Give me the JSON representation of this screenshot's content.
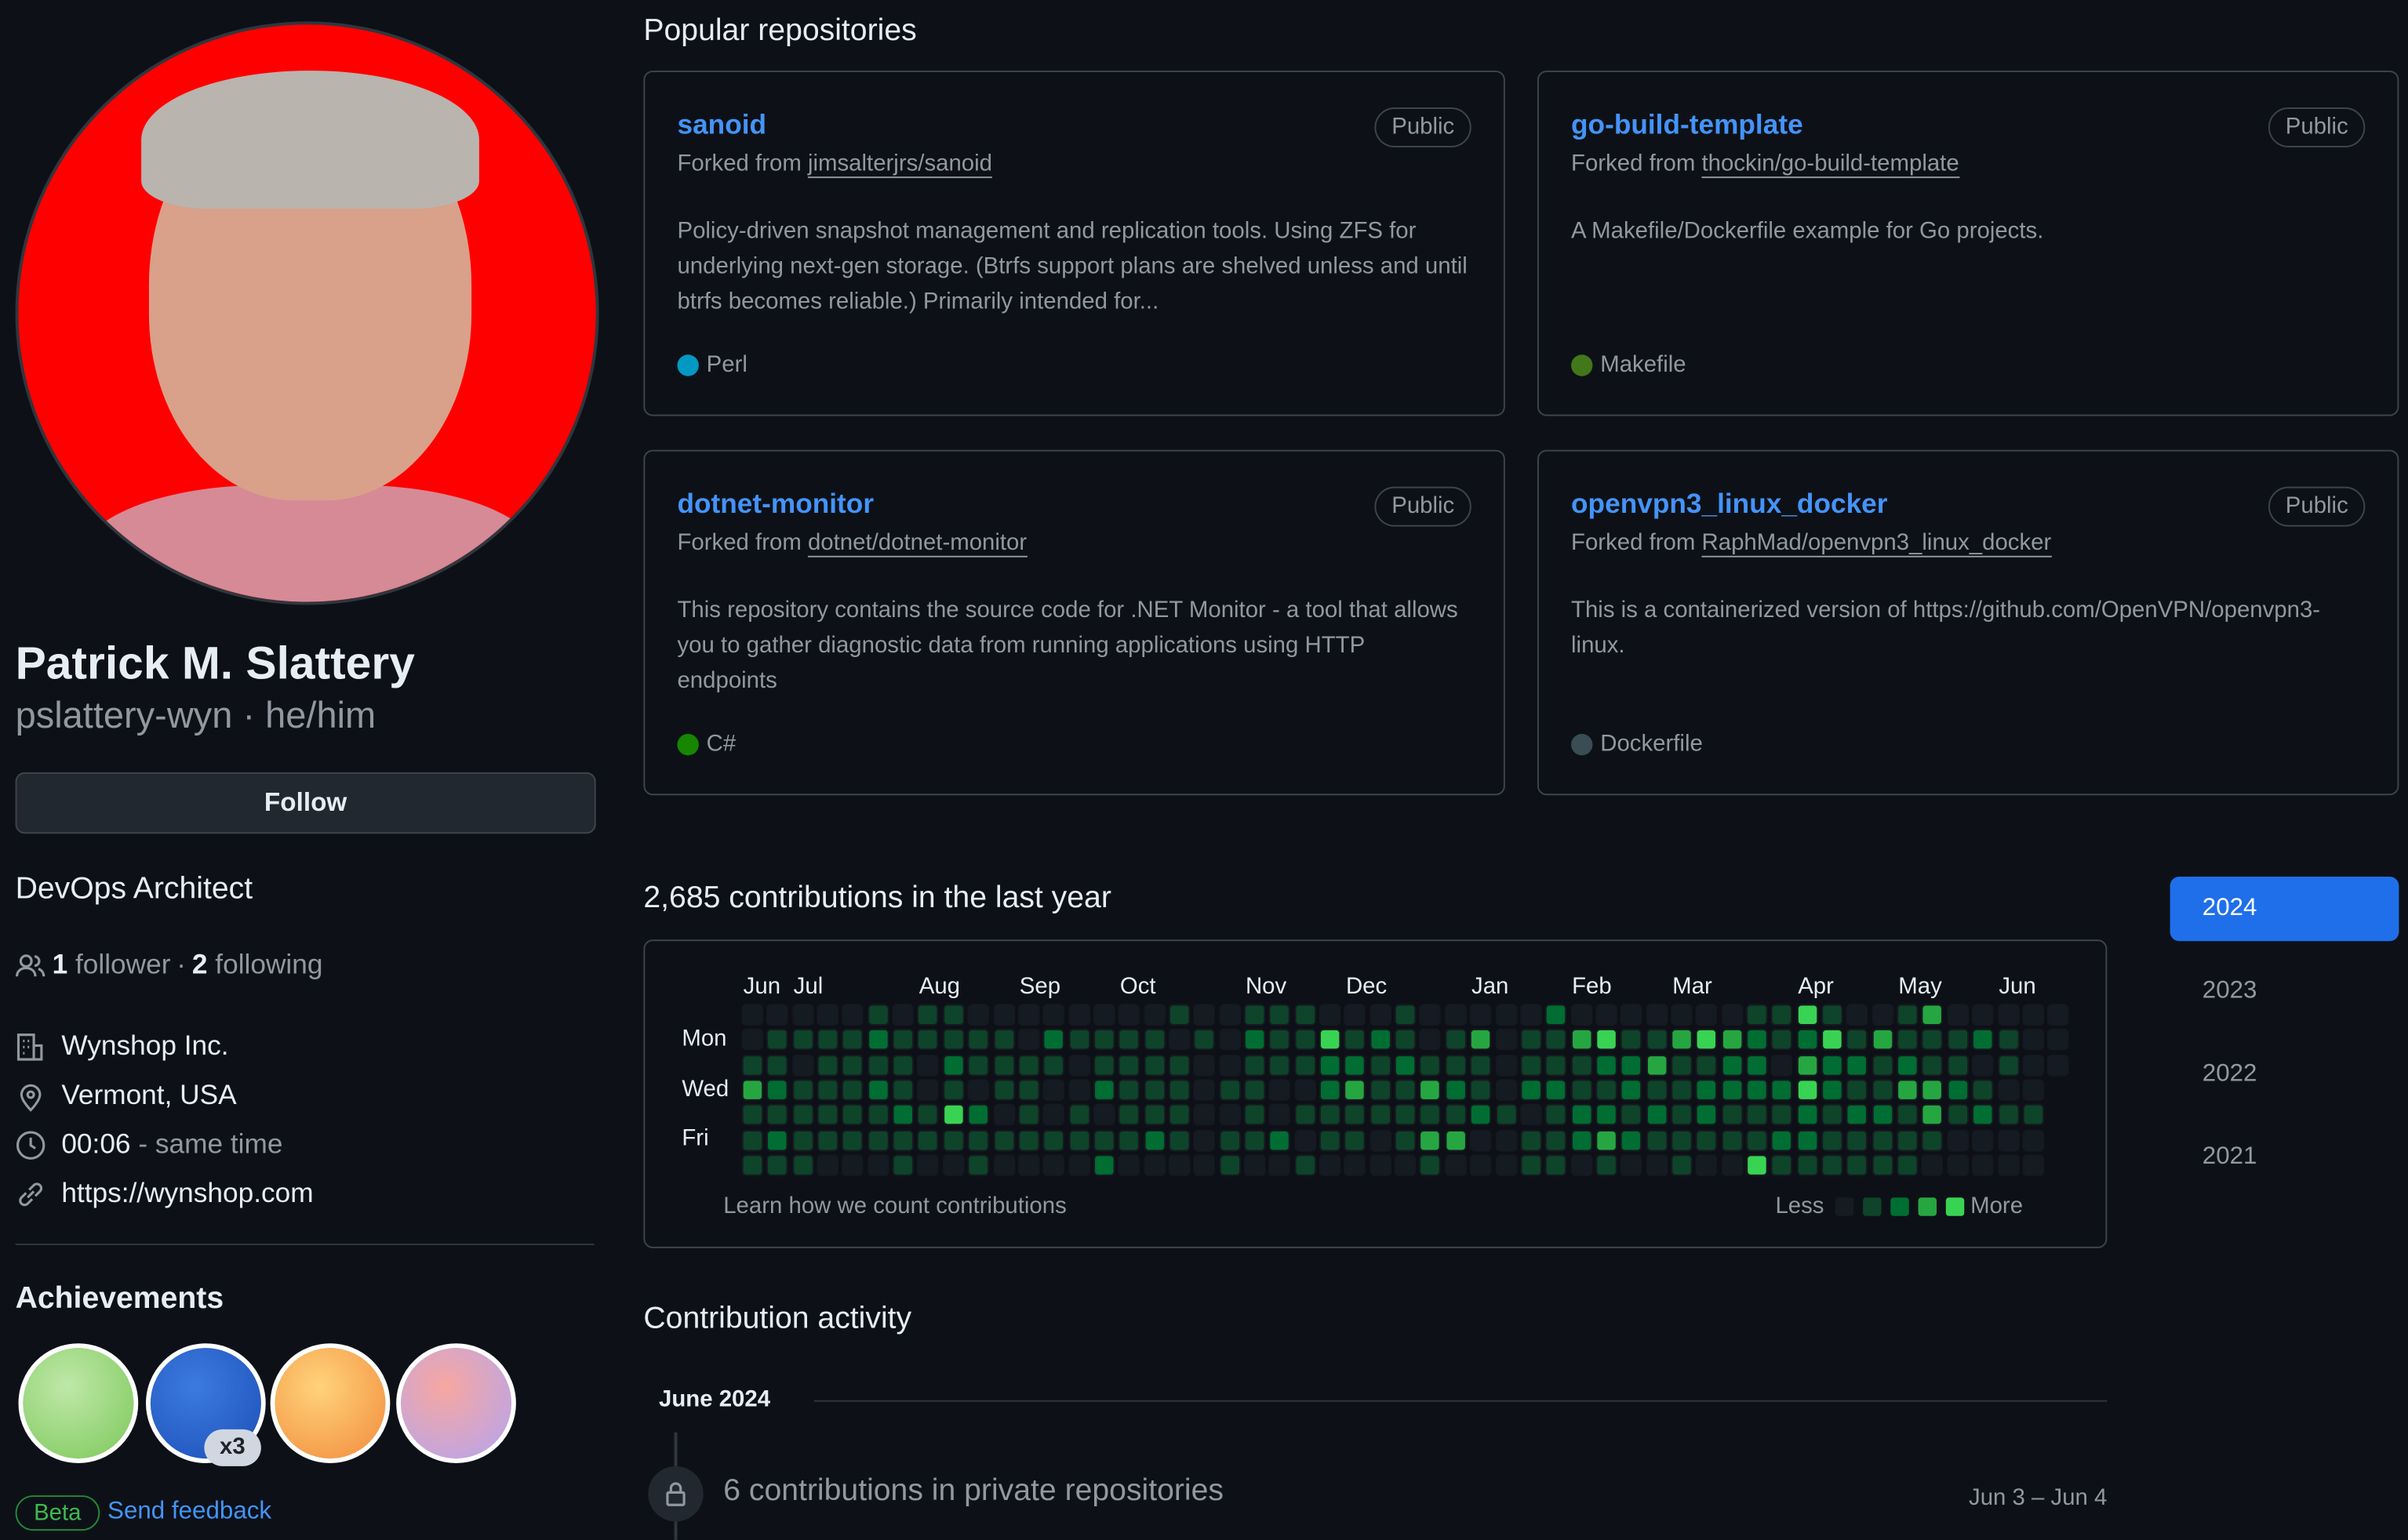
{
  "profile": {
    "name": "Patrick M. Slattery",
    "username_line": "pslattery-wyn · he/him",
    "follow_label": "Follow",
    "bio": "DevOps Architect",
    "followers_count": "1",
    "followers_label": "follower",
    "separator": "·",
    "following_count": "2",
    "following_label": "following",
    "company": "Wynshop Inc.",
    "location": "Vermont, USA",
    "time": "00:06",
    "time_note": "- same time",
    "website": "https://wynshop.com"
  },
  "achievements": {
    "title": "Achievements",
    "badges": [
      {
        "name": "pair-extraordinaire",
        "colors": [
          "#bfe8a8",
          "#7cc85a"
        ]
      },
      {
        "name": "pull-shark",
        "colors": [
          "#3b7be0",
          "#1d4fb8"
        ],
        "count": "x3"
      },
      {
        "name": "quickdraw",
        "colors": [
          "#ffd37a",
          "#f28b3c"
        ]
      },
      {
        "name": "yolo",
        "colors": [
          "#f7a7a0",
          "#b3a4f2"
        ]
      }
    ],
    "beta_label": "Beta",
    "feedback_label": "Send feedback"
  },
  "popular": {
    "title": "Popular repositories",
    "repos": [
      {
        "name": "sanoid",
        "visibility": "Public",
        "fork_prefix": "Forked from",
        "fork_source": "jimsalterjrs/sanoid",
        "description": "Policy-driven snapshot management and replication tools. Using ZFS for underlying next-gen storage. (Btrfs support plans are shelved unless and until btrfs becomes reliable.) Primarily intended for...",
        "language": "Perl",
        "language_color": "#0298c3"
      },
      {
        "name": "go-build-template",
        "visibility": "Public",
        "fork_prefix": "Forked from",
        "fork_source": "thockin/go-build-template",
        "description": "A Makefile/Dockerfile example for Go projects.",
        "language": "Makefile",
        "language_color": "#427819"
      },
      {
        "name": "dotnet-monitor",
        "visibility": "Public",
        "fork_prefix": "Forked from",
        "fork_source": "dotnet/dotnet-monitor",
        "description": "This repository contains the source code for .NET Monitor - a tool that allows you to gather diagnostic data from running applications using HTTP endpoints",
        "language": "C#",
        "language_color": "#178600"
      },
      {
        "name": "openvpn3_linux_docker",
        "visibility": "Public",
        "fork_prefix": "Forked from",
        "fork_source": "RaphMad/openvpn3_linux_docker",
        "description": "This is a containerized version of https://github.com/OpenVPN/openvpn3-linux.",
        "language": "Dockerfile",
        "language_color": "#384d54"
      }
    ]
  },
  "contributions": {
    "title": "2,685 contributions in the last year",
    "months": [
      "Jun",
      "Jul",
      "Aug",
      "Sep",
      "Oct",
      "Nov",
      "Dec",
      "Jan",
      "Feb",
      "Mar",
      "Apr",
      "May",
      "Jun"
    ],
    "month_columns": [
      0,
      2,
      7,
      11,
      15,
      20,
      24,
      29,
      33,
      37,
      42,
      46,
      50
    ],
    "day_labels": [
      "Mon",
      "Wed",
      "Fri"
    ],
    "level_colors": [
      "#151b23",
      "#0e4429",
      "#006d32",
      "#26a641",
      "#39d353"
    ],
    "levels_by_weekday": [
      "00000101100000000100111000100000200000001141001300000",
      "01111211111021111010211412101301134113432124131112100",
      "11011110211110111100111221211101112231122032212110100",
      "3211121010110021110110023113210221121122224211332100",
      "1111112142010101110010111111121012212121112122131211",
      "1211111111111111210112011013300112321111122111110000",
      "1110001001000020000100100001000110100100411111100000"
    ],
    "learn_link": "Learn how we count contributions",
    "legend_less": "Less",
    "legend_more": "More",
    "years": [
      "2024",
      "2023",
      "2022",
      "2021"
    ],
    "selected_year": "2024"
  },
  "activity": {
    "title": "Contribution activity",
    "month": "June 2024",
    "item": "6 contributions in private repositories",
    "range": "Jun 3 – Jun 4"
  }
}
